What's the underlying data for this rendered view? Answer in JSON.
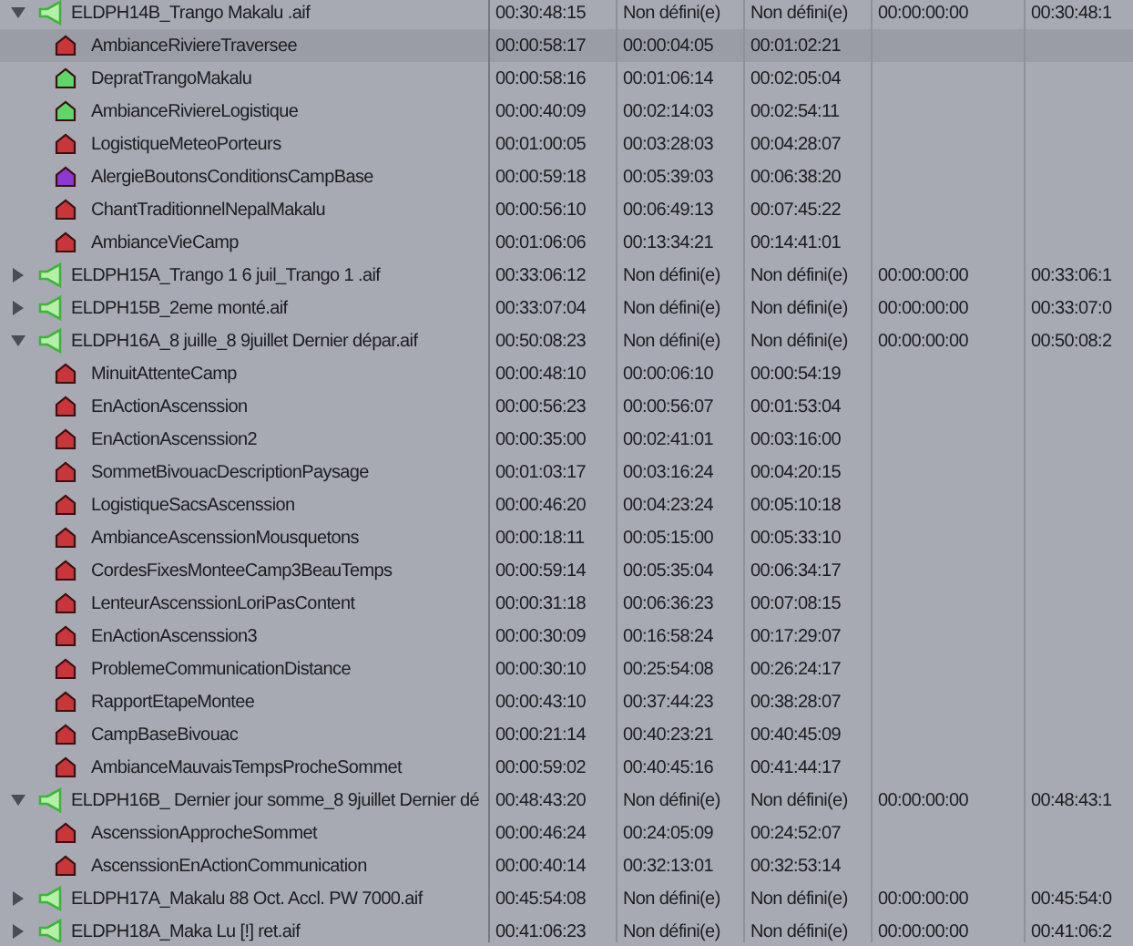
{
  "browser": {
    "items": [
      {
        "name": "ELDPH14B_Trango Makalu .aif",
        "expanded": true,
        "selected": false,
        "column_2": "00:30:48:15",
        "column_3": "Non défini(e)",
        "column_4": "Non défini(e)",
        "column_5": "00:00:00:00",
        "column_6": "00:30:48:1",
        "children": [
          {
            "name": "AmbianceRiviereTraversee",
            "color": "#c8363c",
            "selected": true,
            "column_2": "00:00:58:17",
            "column_3": "00:00:04:05",
            "column_4": "00:01:02:21"
          },
          {
            "name": "DepratTrangoMakalu",
            "color": "#5fd66a",
            "selected": false,
            "column_2": "00:00:58:16",
            "column_3": "00:01:06:14",
            "column_4": "00:02:05:04"
          },
          {
            "name": "AmbianceRiviereLogistique",
            "color": "#5fd66a",
            "selected": false,
            "column_2": "00:00:40:09",
            "column_3": "00:02:14:03",
            "column_4": "00:02:54:11"
          },
          {
            "name": "LogistiqueMeteoPorteurs",
            "color": "#c8363c",
            "selected": false,
            "column_2": "00:01:00:05",
            "column_3": "00:03:28:03",
            "column_4": "00:04:28:07"
          },
          {
            "name": "AlergieBoutonsConditionsCampBase",
            "color": "#8a3ad0",
            "selected": false,
            "column_2": "00:00:59:18",
            "column_3": "00:05:39:03",
            "column_4": "00:06:38:20"
          },
          {
            "name": "ChantTraditionnelNepalMakalu",
            "color": "#c8363c",
            "selected": false,
            "column_2": "00:00:56:10",
            "column_3": "00:06:49:13",
            "column_4": "00:07:45:22"
          },
          {
            "name": "AmbianceVieCamp",
            "color": "#c8363c",
            "selected": false,
            "column_2": "00:01:06:06",
            "column_3": "00:13:34:21",
            "column_4": "00:14:41:01"
          }
        ]
      },
      {
        "name": "ELDPH15A_Trango 1 6 juil_Trango 1 .aif",
        "expanded": false,
        "selected": false,
        "column_2": "00:33:06:12",
        "column_3": "Non défini(e)",
        "column_4": "Non défini(e)",
        "column_5": "00:00:00:00",
        "column_6": "00:33:06:1"
      },
      {
        "name": "ELDPH15B_2eme monté.aif",
        "expanded": false,
        "selected": false,
        "column_2": "00:33:07:04",
        "column_3": "Non défini(e)",
        "column_4": "Non défini(e)",
        "column_5": "00:00:00:00",
        "column_6": "00:33:07:0"
      },
      {
        "name": "ELDPH16A_8 juille_8 9juillet Dernier dépar.aif",
        "expanded": true,
        "selected": false,
        "column_2": "00:50:08:23",
        "column_3": "Non défini(e)",
        "column_4": "Non défini(e)",
        "column_5": "00:00:00:00",
        "column_6": "00:50:08:2",
        "children": [
          {
            "name": "MinuitAttenteCamp",
            "color": "#c8363c",
            "selected": false,
            "column_2": "00:00:48:10",
            "column_3": "00:00:06:10",
            "column_4": "00:00:54:19"
          },
          {
            "name": "EnActionAscenssion",
            "color": "#c8363c",
            "selected": false,
            "column_2": "00:00:56:23",
            "column_3": "00:00:56:07",
            "column_4": "00:01:53:04"
          },
          {
            "name": "EnActionAscenssion2",
            "color": "#c8363c",
            "selected": false,
            "column_2": "00:00:35:00",
            "column_3": "00:02:41:01",
            "column_4": "00:03:16:00"
          },
          {
            "name": "SommetBivouacDescriptionPaysage",
            "color": "#c8363c",
            "selected": false,
            "column_2": "00:01:03:17",
            "column_3": "00:03:16:24",
            "column_4": "00:04:20:15"
          },
          {
            "name": "LogistiqueSacsAscenssion",
            "color": "#c8363c",
            "selected": false,
            "column_2": "00:00:46:20",
            "column_3": "00:04:23:24",
            "column_4": "00:05:10:18"
          },
          {
            "name": "AmbianceAscenssionMousquetons",
            "color": "#c8363c",
            "selected": false,
            "column_2": "00:00:18:11",
            "column_3": "00:05:15:00",
            "column_4": "00:05:33:10"
          },
          {
            "name": "CordesFixesMonteeCamp3BeauTemps",
            "color": "#c8363c",
            "selected": false,
            "column_2": "00:00:59:14",
            "column_3": "00:05:35:04",
            "column_4": "00:06:34:17"
          },
          {
            "name": "LenteurAscenssionLoriPasContent",
            "color": "#c8363c",
            "selected": false,
            "column_2": "00:00:31:18",
            "column_3": "00:06:36:23",
            "column_4": "00:07:08:15"
          },
          {
            "name": "EnActionAscenssion3",
            "color": "#c8363c",
            "selected": false,
            "column_2": "00:00:30:09",
            "column_3": "00:16:58:24",
            "column_4": "00:17:29:07"
          },
          {
            "name": "ProblemeCommunicationDistance",
            "color": "#c8363c",
            "selected": false,
            "column_2": "00:00:30:10",
            "column_3": "00:25:54:08",
            "column_4": "00:26:24:17"
          },
          {
            "name": "RapportEtapeMontee",
            "color": "#c8363c",
            "selected": false,
            "column_2": "00:00:43:10",
            "column_3": "00:37:44:23",
            "column_4": "00:38:28:07"
          },
          {
            "name": "CampBaseBivouac",
            "color": "#c8363c",
            "selected": false,
            "column_2": "00:00:21:14",
            "column_3": "00:40:23:21",
            "column_4": "00:40:45:09"
          },
          {
            "name": "AmbianceMauvaisTempsProcheSommet",
            "color": "#c8363c",
            "selected": false,
            "column_2": "00:00:59:02",
            "column_3": "00:40:45:16",
            "column_4": "00:41:44:17"
          }
        ]
      },
      {
        "name": "ELDPH16B_ Dernier jour somme_8 9juillet Dernier dé",
        "expanded": true,
        "selected": false,
        "column_2": "00:48:43:20",
        "column_3": "Non défini(e)",
        "column_4": "Non défini(e)",
        "column_5": "00:00:00:00",
        "column_6": "00:48:43:1",
        "children": [
          {
            "name": "AscenssionApprocheSommet",
            "color": "#c8363c",
            "selected": false,
            "column_2": "00:00:46:24",
            "column_3": "00:24:05:09",
            "column_4": "00:24:52:07"
          },
          {
            "name": "AscenssionEnActionCommunication",
            "color": "#c8363c",
            "selected": false,
            "column_2": "00:00:40:14",
            "column_3": "00:32:13:01",
            "column_4": "00:32:53:14"
          }
        ]
      },
      {
        "name": "ELDPH17A_Makalu 88 Oct. Accl. PW 7000.aif",
        "expanded": false,
        "selected": false,
        "column_2": "00:45:54:08",
        "column_3": "Non défini(e)",
        "column_4": "Non défini(e)",
        "column_5": "00:00:00:00",
        "column_6": "00:45:54:0"
      },
      {
        "name": "ELDPH18A_Maka Lu [!] ret.aif",
        "expanded": false,
        "selected": false,
        "column_2": "00:41:06:23",
        "column_3": "Non défini(e)",
        "column_4": "Non défini(e)",
        "column_5": "00:00:00:00",
        "column_6": "00:41:06:2"
      }
    ]
  }
}
